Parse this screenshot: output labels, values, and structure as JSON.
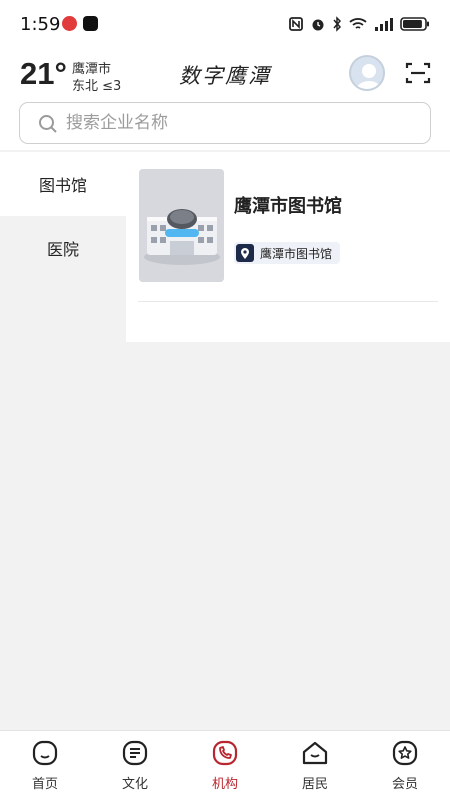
{
  "status_bar": {
    "time": "1:59",
    "battery_level": 0.9
  },
  "header": {
    "temperature": "21°",
    "city": "鹰潭市",
    "wind": "东北 ≤3",
    "app_title": "数字鹰潭"
  },
  "search": {
    "placeholder": "搜索企业名称"
  },
  "categories": [
    {
      "label": "图书馆",
      "active": true
    },
    {
      "label": "医院",
      "active": false
    }
  ],
  "results": [
    {
      "title": "鹰潭市图书馆",
      "tag": "鹰潭市图书馆",
      "thumbnail": "library-building-image"
    }
  ],
  "bottom_nav": [
    {
      "label": "首页",
      "icon": "home-icon",
      "active": false
    },
    {
      "label": "文化",
      "icon": "culture-icon",
      "active": false
    },
    {
      "label": "机构",
      "icon": "institution-icon",
      "active": true
    },
    {
      "label": "居民",
      "icon": "resident-icon",
      "active": false
    },
    {
      "label": "会员",
      "icon": "member-icon",
      "active": false
    }
  ],
  "colors": {
    "accent": "#b8262f",
    "background": "#f2f2f2",
    "tag_background": "#eef1f7"
  }
}
